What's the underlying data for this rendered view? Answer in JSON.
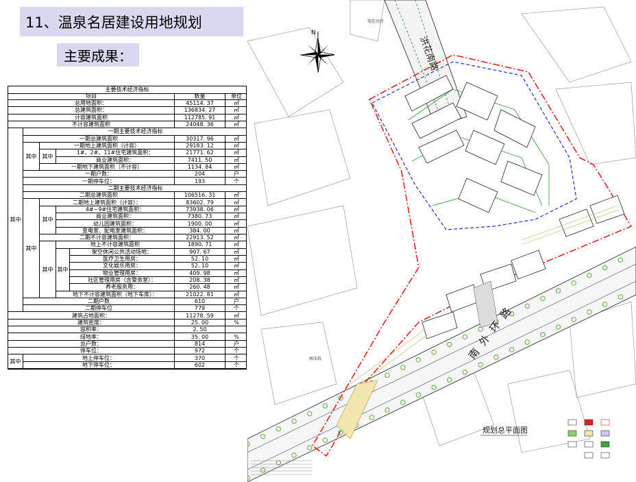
{
  "title": "11、温泉名居建设用地规划",
  "subtitle": "主要成果：",
  "table": {
    "caption": "主要技术经济指标",
    "header": {
      "item": "项目",
      "value": "数量",
      "unit": "单位"
    },
    "rows": [
      {
        "label": "总用地面积：",
        "value": "45114. 37",
        "unit": "㎡",
        "indent": 0
      },
      {
        "label": "总建筑面积：",
        "value": "136834. 27",
        "unit": "㎡",
        "indent": 0
      },
      {
        "label": "计容建筑面积",
        "value": "112785. 91",
        "unit": "㎡",
        "indent": 0
      },
      {
        "label": "不计容建筑面积",
        "value": "24048. 36",
        "unit": "㎡",
        "indent": 0
      },
      {
        "label": "一期主要技术经济指标",
        "value": "",
        "unit": "",
        "indent": 1,
        "section": true
      },
      {
        "label": "一期总建筑面积",
        "value": "30317. 96",
        "unit": "㎡",
        "indent": 1
      },
      {
        "label": "一期地上建筑面积（计容）",
        "value": "29183. 12",
        "unit": "㎡",
        "indent": 2
      },
      {
        "label": "1#、2#、11#住宅建筑面积：",
        "value": "21771. 62",
        "unit": "㎡",
        "indent": 3
      },
      {
        "label": "商业建筑面积：",
        "value": "7411. 50",
        "unit": "㎡",
        "indent": 3
      },
      {
        "label": "一期地下建筑面积（不计容）",
        "value": "1134. 84",
        "unit": "㎡",
        "indent": 2
      },
      {
        "label": "一期户数：",
        "value": "204",
        "unit": "户",
        "indent": 1
      },
      {
        "label": "一期停车位：",
        "value": "193",
        "unit": "个",
        "indent": 1
      },
      {
        "label": "二期主要技术经济指标",
        "value": "",
        "unit": "",
        "indent": 1,
        "section": true
      },
      {
        "label": "二期总建筑面积",
        "value": "106516. 31",
        "unit": "㎡",
        "indent": 1
      },
      {
        "label": "二期地上建筑面积（计容）：",
        "value": "83602. 79",
        "unit": "㎡",
        "indent": 2
      },
      {
        "label": "4#~9#住宅建筑面积：",
        "value": "73938. 06",
        "unit": "㎡",
        "indent": 3
      },
      {
        "label": "商业建筑面积：",
        "value": "7380. 73",
        "unit": "㎡",
        "indent": 3
      },
      {
        "label": "幼儿园建筑面积：",
        "value": "1900. 00",
        "unit": "㎡",
        "indent": 3
      },
      {
        "label": "变电室、配电室建筑面积：",
        "value": "384. 00",
        "unit": "㎡",
        "indent": 3
      },
      {
        "label": "二期不计容建筑面积：",
        "value": "22913. 52",
        "unit": "㎡",
        "indent": 2
      },
      {
        "label": "地上不计容建筑面积",
        "value": "1890. 71",
        "unit": "㎡",
        "indent": 3
      },
      {
        "label": "架空休闲公共活动场地：",
        "value": "907. 67",
        "unit": "㎡",
        "indent": 4
      },
      {
        "label": "医疗卫生用房：",
        "value": "52. 10",
        "unit": "㎡",
        "indent": 4
      },
      {
        "label": "文化娱乐用房：",
        "value": "52. 10",
        "unit": "㎡",
        "indent": 4
      },
      {
        "label": "物业管理用房：",
        "value": "409. 98",
        "unit": "㎡",
        "indent": 4
      },
      {
        "label": "社区管理用房（含警务室）：",
        "value": "208. 38",
        "unit": "㎡",
        "indent": 4
      },
      {
        "label": "养老服务用：",
        "value": "260. 48",
        "unit": "㎡",
        "indent": 4
      },
      {
        "label": "地下不计容建筑面积（地下车库）：",
        "value": "21022. 81",
        "unit": "㎡",
        "indent": 3
      },
      {
        "label": "二期户数",
        "value": "610",
        "unit": "户",
        "indent": 1
      },
      {
        "label": "二期停车位",
        "value": "779",
        "unit": "个",
        "indent": 1
      },
      {
        "label": "建筑占地面积：",
        "value": "11278. 59",
        "unit": "㎡",
        "indent": 0
      },
      {
        "label": "建筑密度：",
        "value": "25. 00",
        "unit": "%",
        "indent": 0
      },
      {
        "label": "容积率：",
        "value": "2. 50",
        "unit": "",
        "indent": 0
      },
      {
        "label": "绿地率：",
        "value": "35. 00",
        "unit": "%",
        "indent": 0
      },
      {
        "label": "总户数：",
        "value": "814",
        "unit": "户",
        "indent": 0
      },
      {
        "label": "停车位：",
        "value": "972",
        "unit": "个",
        "indent": 0
      },
      {
        "label": "地上停车位：",
        "value": "370",
        "unit": "个",
        "indent": 1
      },
      {
        "label": "地下停车位：",
        "value": "602",
        "unit": "个",
        "indent": 1
      }
    ],
    "group_label": "其中"
  },
  "map": {
    "north_label": "N",
    "road_name_vertical": "洪花南路",
    "road_name_main": "南外环路",
    "plan_title": "规划总平面图",
    "label_telecom": "电信光纤",
    "label_hv": "高压线",
    "colors": {
      "boundary_red": "#e02020",
      "blue_line": "#2030c0",
      "road_green": "#40a040",
      "tree_green": "#60b040"
    }
  }
}
